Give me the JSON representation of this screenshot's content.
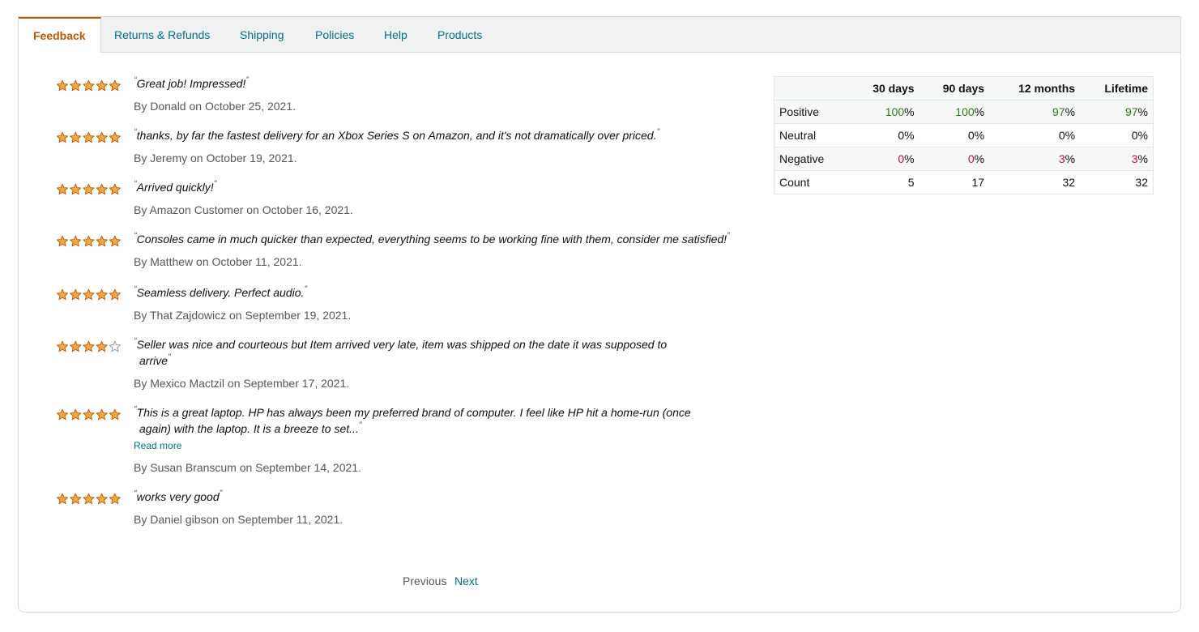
{
  "tabs": [
    {
      "label": "Feedback"
    },
    {
      "label": "Returns & Refunds"
    },
    {
      "label": "Shipping"
    },
    {
      "label": "Policies"
    },
    {
      "label": "Help"
    },
    {
      "label": "Products"
    }
  ],
  "colors": {
    "star": "#f3a847",
    "star_stroke": "#c45500",
    "accent": "#c45500",
    "link": "#007185",
    "positive": "#2c7a14",
    "negative": "#cc0c39"
  },
  "reviews": [
    {
      "rating": 5,
      "quote": "Great job! Impressed!",
      "by": "By Donald on October 25, 2021."
    },
    {
      "rating": 5,
      "quote": "thanks, by far the fastest delivery for an Xbox Series S on Amazon, and it's not dramatically over priced.",
      "by": "By Jeremy on October 19, 2021."
    },
    {
      "rating": 5,
      "quote": "Arrived quickly!",
      "by": "By Amazon Customer on October 16, 2021."
    },
    {
      "rating": 5,
      "quote": "Consoles came in much quicker than expected, everything seems to be working fine with them, consider me satisfied!",
      "by": "By Matthew on October 11, 2021."
    },
    {
      "rating": 5,
      "quote": "Seamless delivery. Perfect audio.",
      "by": "By That Zajdowicz on September 19, 2021."
    },
    {
      "rating": 4,
      "quote": "Seller was nice and courteous but Item arrived very late, item was shipped on the date it was supposed to arrive",
      "by": "By Mexico Mactzil on September 17, 2021."
    },
    {
      "rating": 5,
      "quote": "This is a great laptop. HP has always been my preferred brand of computer. I feel like HP hit a home-run (once again) with the laptop. It is a breeze to set...",
      "by": "By Susan Branscum on September 14, 2021.",
      "read_more": "Read more"
    },
    {
      "rating": 5,
      "quote": "works very good",
      "by": "By Daniel gibson on September 11, 2021."
    }
  ],
  "summary": {
    "headers": [
      "",
      "30 days",
      "90 days",
      "12 months",
      "Lifetime"
    ],
    "rows": [
      {
        "label": "Positive",
        "values": [
          "100",
          "100",
          "97",
          "97"
        ],
        "suffix": "%"
      },
      {
        "label": "Neutral",
        "values": [
          "0",
          "0",
          "0",
          "0"
        ],
        "suffix": "%"
      },
      {
        "label": "Negative",
        "values": [
          "0",
          "0",
          "3",
          "3"
        ],
        "suffix": "%"
      },
      {
        "label": "Count",
        "values": [
          "5",
          "17",
          "32",
          "32"
        ],
        "suffix": ""
      }
    ]
  },
  "pagination": {
    "previous": "Previous",
    "next": "Next"
  }
}
